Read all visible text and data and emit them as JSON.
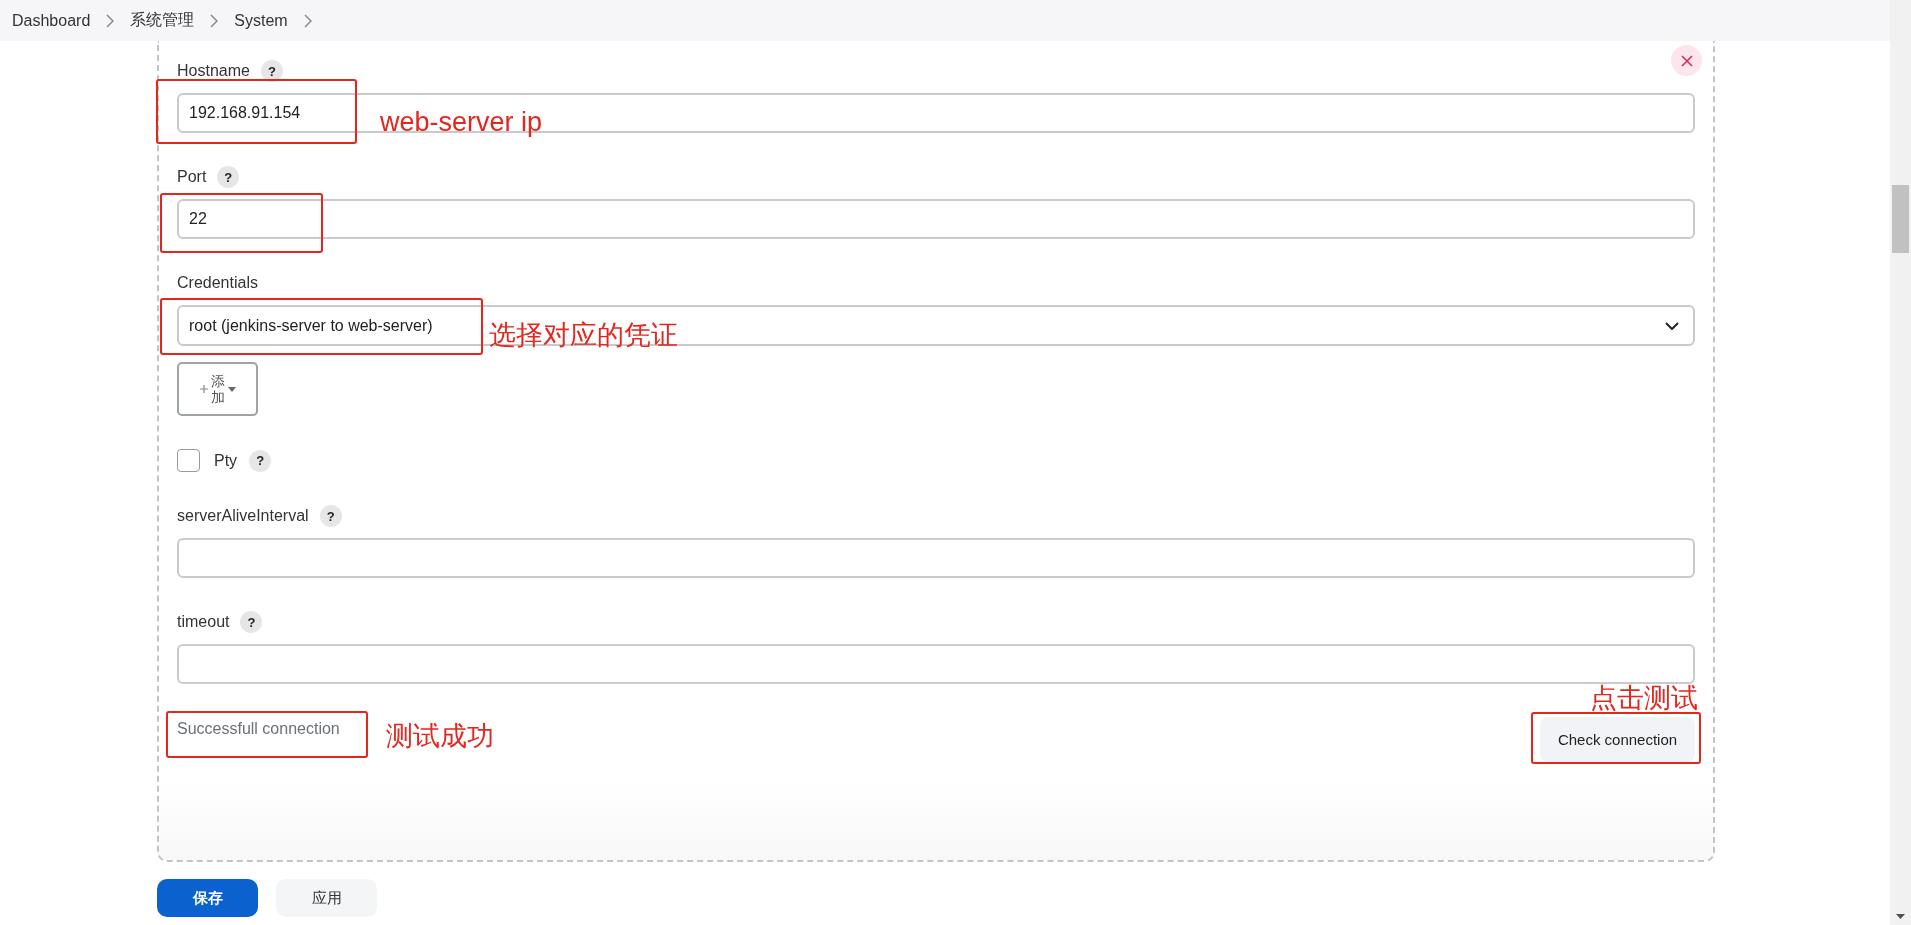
{
  "breadcrumb": [
    {
      "label": "Dashboard"
    },
    {
      "label": "系统管理"
    },
    {
      "label": "System"
    }
  ],
  "panel": {
    "fields": [
      {
        "kind": "text",
        "label": "Hostname",
        "help": "?",
        "value": "192.168.91.154",
        "marked": true,
        "note": "web-server ip"
      },
      {
        "kind": "text",
        "label": "Port",
        "help": "?",
        "value": "22",
        "marked": true
      },
      {
        "kind": "select",
        "label": "Credentials",
        "value": "root (jenkins-server to web-server)",
        "marked": true,
        "note": "选择对应的凭证",
        "add_button": {
          "label": "添加"
        }
      },
      {
        "kind": "checkbox",
        "label": "Pty",
        "help": "?",
        "checked": false,
        "marked": false
      },
      {
        "kind": "text",
        "label": "serverAliveInterval",
        "help": "?",
        "marked": false
      },
      {
        "kind": "text",
        "label": "timeout",
        "help": "?",
        "marked": false
      }
    ],
    "status": {
      "text": "Successfull connection",
      "marked": true,
      "note": "测试成功"
    },
    "check_button": {
      "label": "Check connection",
      "marked": true,
      "note": "点击测试"
    }
  },
  "footer": {
    "buttons": [
      {
        "label": "保存",
        "kind": "primary"
      },
      {
        "label": "应用",
        "kind": "secondary"
      }
    ]
  }
}
